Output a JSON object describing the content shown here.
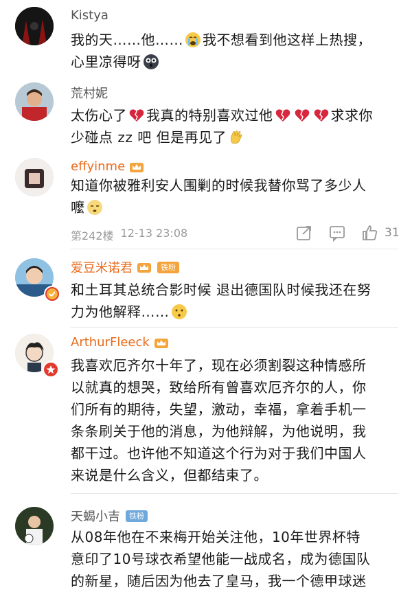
{
  "comments": [
    {
      "username": "Kistya",
      "line1": "我的天……他……",
      "line1b": "我不想看到他这样上热搜，",
      "line2": "心里凉得呀"
    },
    {
      "username": "荒村妮",
      "line1": "太伤心了",
      "line1b": "我真的特别喜欢过他",
      "line1c": "求求你",
      "line2": "少碰点 zz 吧 但是再见了"
    },
    {
      "username": "effyinme",
      "line1": "知道你被雅利安人围剿的时候我替你骂了多少人",
      "line2": "嚒",
      "floor": "第242楼",
      "time": "12-13 23:08",
      "likes": "31"
    },
    {
      "username": "爱豆米诺君",
      "badge": "铁粉",
      "line1": "和土耳其总统合影时候 退出德国队时候我还在努",
      "line2": "力为他解释……"
    },
    {
      "username": "ArthurFleeck",
      "lines": [
        "我喜欢厄齐尔十年了，现在必须割裂这种情感所",
        "以就真的想哭，致给所有曾喜欢厄齐尔的人，你",
        "们所有的期待，失望，激动，幸福，拿着手机一",
        "条条刷关于他的消息，为他辩解，为他说明，我",
        "都干过。也许他不知道这个行为对于我们中国人",
        "来说是什么含义，但都结束了。"
      ]
    },
    {
      "username": "天蝎小吉",
      "badge": "铁粉",
      "lines": [
        "从08年他在不来梅开始关注他，10年世界杯特",
        "意印了10号球衣希望他能一战成名，成为德国队",
        "的新星，随后因为他去了皇马，我一个德甲球迷"
      ]
    }
  ],
  "colors": {
    "vip_name": "#e86b1c",
    "normal_name": "#555555",
    "badge_orange": "#f4a43c",
    "badge_blue": "#6fa8dc"
  }
}
